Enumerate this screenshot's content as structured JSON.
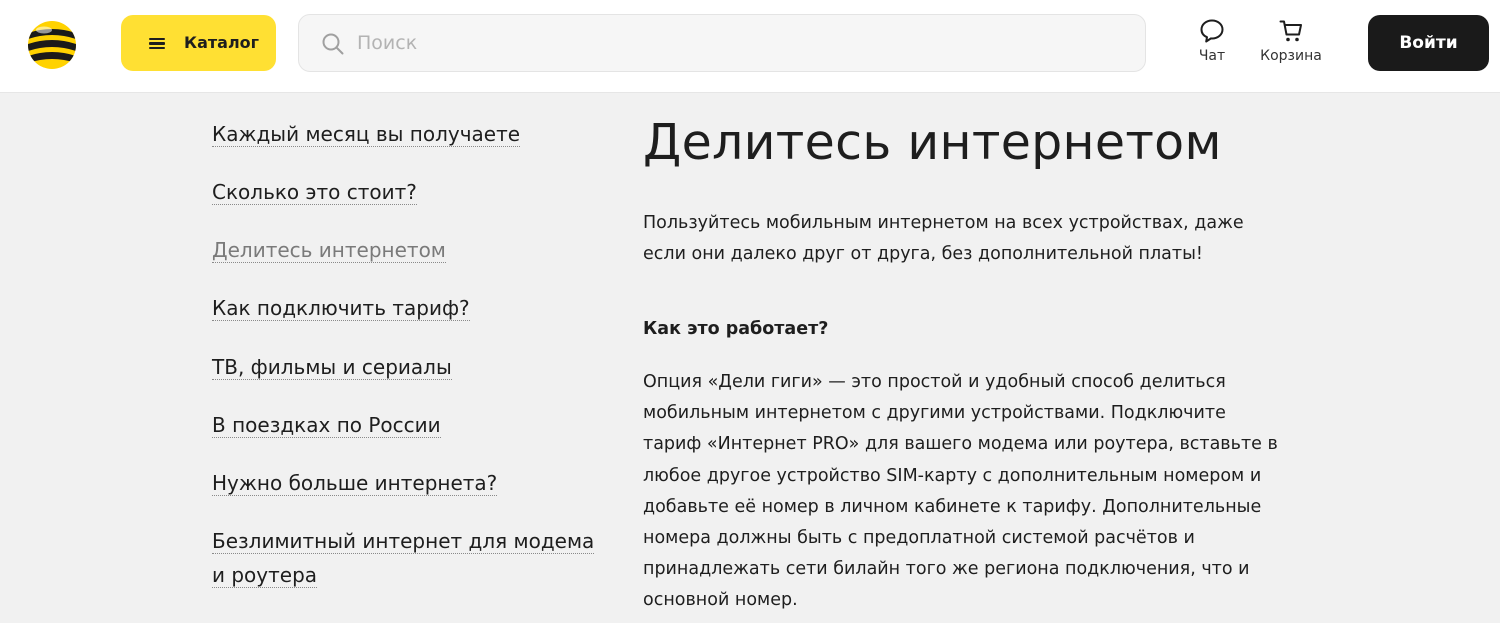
{
  "header": {
    "logo_icon": "beeline-logo",
    "catalog_label": "Каталог",
    "search_placeholder": "Поиск",
    "chat_label": "Чат",
    "cart_label": "Корзина",
    "login_label": "Войти"
  },
  "nav": {
    "items": [
      {
        "label": "Каждый месяц вы получаете"
      },
      {
        "label": "Сколько это стоит?"
      },
      {
        "label": "Делитесь интернетом"
      },
      {
        "label": "Как подключить тариф?"
      },
      {
        "label": "ТВ, фильмы и сериалы"
      },
      {
        "label": "В поездках по России"
      },
      {
        "label": "Нужно больше интернета?"
      },
      {
        "label": "Безлимитный интернет для модема и роутера"
      }
    ]
  },
  "main": {
    "title": "Делитесь интернетом",
    "lead": "Пользуйтесь мобильным интернетом на всех устройствах, даже если они далеко друг от друга, без дополнительной платы!",
    "subhead": "Как это работает?",
    "body": "Опция «Дели гиги» — это простой и удобный способ делиться мобильным интернетом с другими устройствами. Подключите тариф «Интернет PRO» для вашего модема или роутера, вставьте в любое другое устройство SIM-карту с дополнительным номером и добавьте её номер в личном кабинете к тарифу. Дополнительные номера должны быть с предоплатной системой расчётов и принадлежать сети билайн того же региона подключения, что и основной номер."
  },
  "colors": {
    "accent": "#ffe033",
    "dark_button": "#1a1a1a",
    "page_bg": "#f1f1f1"
  }
}
